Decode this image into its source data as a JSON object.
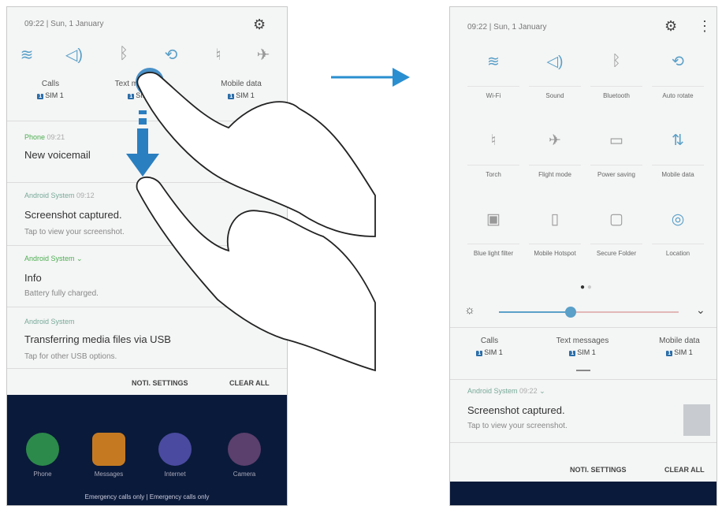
{
  "left": {
    "status": "09:22 | Sun, 1 January",
    "quick_labels": [
      {
        "title": "Calls",
        "sim": "SIM 1"
      },
      {
        "title": "Text messages",
        "sim": "SIM 1"
      },
      {
        "title": "Mobile data",
        "sim": "SIM 1"
      }
    ],
    "notifications": [
      {
        "app": "Phone",
        "time": "09:21",
        "title": "New voicemail",
        "sub": ""
      },
      {
        "app": "Android System",
        "time": "09:12",
        "title": "Screenshot captured.",
        "sub": "Tap to view your screenshot."
      },
      {
        "app": "Android System",
        "time": "",
        "title": "Info",
        "sub": "Battery fully charged."
      },
      {
        "app": "Android System",
        "time": "",
        "title": "Transferring media files via USB",
        "sub": "Tap for other USB options."
      }
    ],
    "buttons": {
      "settings": "NOTI. SETTINGS",
      "clear": "CLEAR ALL"
    },
    "dock_apps": [
      "Phone",
      "Messages",
      "Internet",
      "Camera"
    ],
    "emergency": "Emergency calls only | Emergency calls only"
  },
  "right": {
    "status": "09:22 | Sun, 1 January",
    "tiles": [
      {
        "label": "Wi-Fi",
        "icon": "wifi-icon"
      },
      {
        "label": "Sound",
        "icon": "sound-icon"
      },
      {
        "label": "Bluetooth",
        "icon": "bluetooth-icon"
      },
      {
        "label": "Auto rotate",
        "icon": "rotate-icon"
      },
      {
        "label": "Torch",
        "icon": "torch-icon"
      },
      {
        "label": "Flight mode",
        "icon": "airplane-icon"
      },
      {
        "label": "Power saving",
        "icon": "battery-icon"
      },
      {
        "label": "Mobile data",
        "icon": "data-arrows-icon"
      },
      {
        "label": "Blue light filter",
        "icon": "bluelight-icon"
      },
      {
        "label": "Mobile Hotspot",
        "icon": "hotspot-icon"
      },
      {
        "label": "Secure Folder",
        "icon": "folder-icon"
      },
      {
        "label": "Location",
        "icon": "location-icon"
      }
    ],
    "quick_labels": [
      {
        "title": "Calls",
        "sim": "SIM 1"
      },
      {
        "title": "Text messages",
        "sim": "SIM 1"
      },
      {
        "title": "Mobile data",
        "sim": "SIM 1"
      }
    ],
    "notification": {
      "app": "Android System",
      "time": "09:22",
      "title": "Screenshot captured.",
      "sub": "Tap to view your screenshot."
    },
    "buttons": {
      "settings": "NOTI. SETTINGS",
      "clear": "CLEAR ALL"
    },
    "brightness_level": 0.4
  },
  "colors": {
    "accent": "#5aa0c8",
    "arrow": "#2a8fd0"
  }
}
